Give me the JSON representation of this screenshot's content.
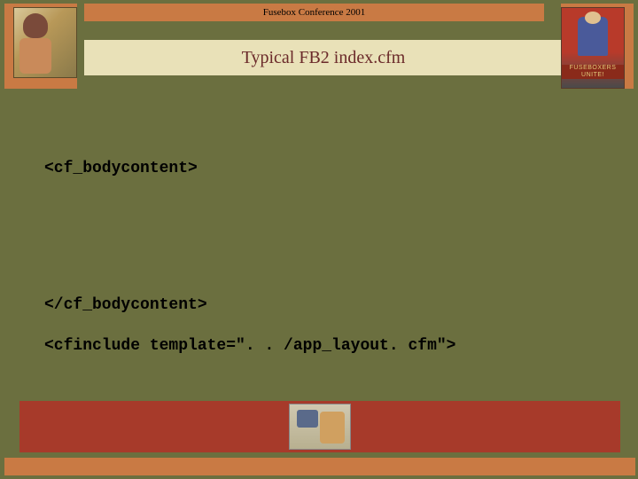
{
  "header": {
    "conference": "Fusebox Conference 2001"
  },
  "title": "Typical FB2 index.cfm",
  "code": {
    "line1": "<cf_bodycontent>",
    "line2": "</cf_bodycontent>",
    "line3": "<cfinclude template=\". . /app_layout. cfm\">"
  },
  "banner": {
    "line1": "FUSEBOXERS",
    "line2": "UNITE!"
  }
}
